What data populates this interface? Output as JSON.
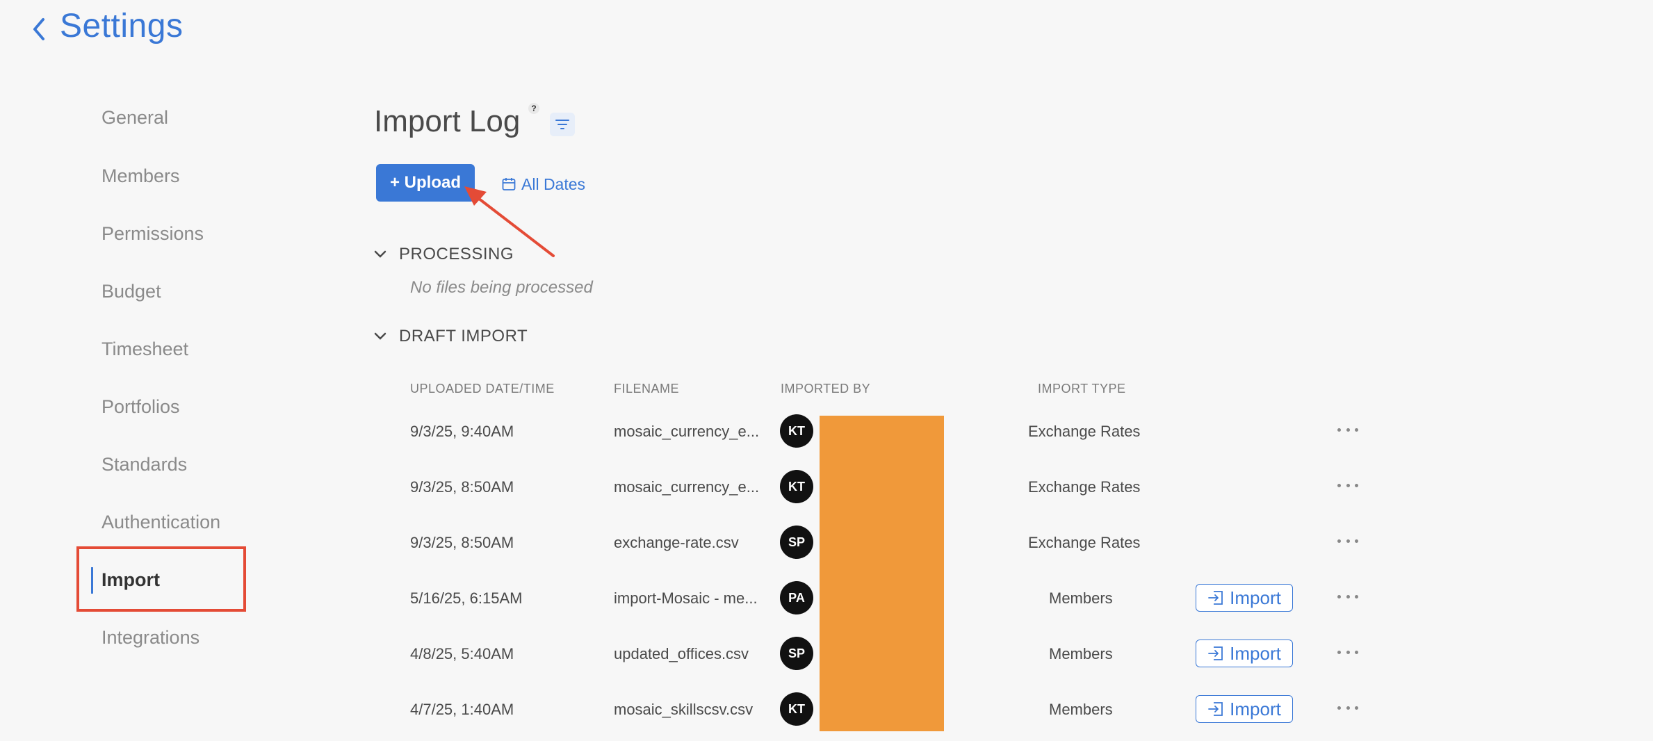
{
  "header": {
    "title": "Settings"
  },
  "sidebar": {
    "items": [
      {
        "label": "General"
      },
      {
        "label": "Members"
      },
      {
        "label": "Permissions"
      },
      {
        "label": "Budget"
      },
      {
        "label": "Timesheet"
      },
      {
        "label": "Portfolios"
      },
      {
        "label": "Standards"
      },
      {
        "label": "Authentication"
      },
      {
        "label": "Import",
        "active": true
      },
      {
        "label": "Integrations"
      }
    ]
  },
  "main": {
    "title": "Import Log",
    "help_icon": "?",
    "upload_label": "+ Upload",
    "dates_label": "All Dates",
    "processing": {
      "label": "PROCESSING",
      "empty": "No files being processed"
    },
    "draft": {
      "label": "DRAFT IMPORT"
    },
    "columns": [
      "UPLOADED DATE/TIME",
      "FILENAME",
      "IMPORTED BY",
      "IMPORT TYPE"
    ],
    "import_label": "Import",
    "rows": [
      {
        "date": "9/3/25, 9:40AM",
        "filename": "mosaic_currency_e...",
        "initials": "KT",
        "type": "Exchange Rates",
        "importable": false
      },
      {
        "date": "9/3/25, 8:50AM",
        "filename": "mosaic_currency_e...",
        "initials": "KT",
        "type": "Exchange Rates",
        "importable": false
      },
      {
        "date": "9/3/25, 8:50AM",
        "filename": "exchange-rate.csv",
        "initials": "SP",
        "type": "Exchange Rates",
        "importable": false
      },
      {
        "date": "5/16/25, 6:15AM",
        "filename": "import-Mosaic - me...",
        "initials": "PA",
        "type": "Members",
        "importable": true
      },
      {
        "date": "4/8/25, 5:40AM",
        "filename": "updated_offices.csv",
        "initials": "SP",
        "type": "Members",
        "importable": true
      },
      {
        "date": "4/7/25, 1:40AM",
        "filename": "mosaic_skillscsv.csv",
        "initials": "KT",
        "type": "Members",
        "importable": true
      }
    ]
  },
  "colors": {
    "accent": "#3a78d6",
    "highlight": "#e44b36",
    "redaction": "#f0993a"
  },
  "icons": {
    "back": "chevron-left-icon",
    "filter": "filter-icon",
    "calendar": "calendar-icon",
    "collapse": "chevron-down-icon",
    "import": "import-icon",
    "more": "more-horizontal-icon"
  }
}
